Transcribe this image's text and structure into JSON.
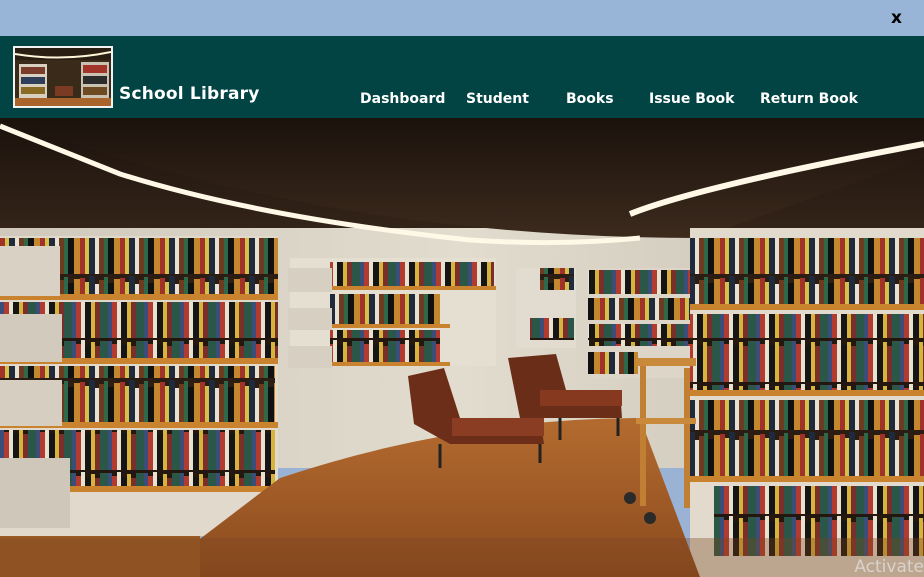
{
  "window": {
    "close_label": "x"
  },
  "header": {
    "title": "School Library",
    "logo_icon": "library-photo"
  },
  "nav": {
    "dashboard": "Dashboard",
    "student": "Student",
    "books": "Books",
    "issue_book": "Issue Book",
    "return_book": "Return Book"
  },
  "colors": {
    "titlebar": "#98b4d6",
    "header": "#024343",
    "nav_text": "#ffffff"
  },
  "watermark": "Activate"
}
